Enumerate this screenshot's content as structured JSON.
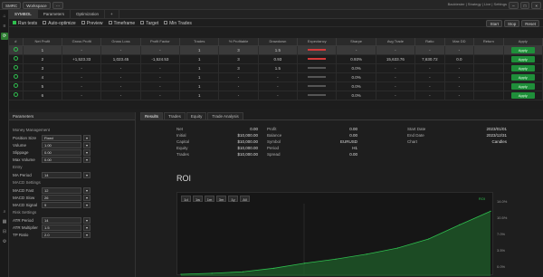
{
  "topbar": {
    "left_buttons": [
      "SMRC",
      "Workspace",
      "⋯"
    ],
    "right_text": "Backtester | Strategy | Live | Settings"
  },
  "tabs": [
    "SYMBOL",
    "Parameters",
    "Optimization",
    "+"
  ],
  "rail_icons": [
    "home-icon",
    "search-icon",
    "settings-icon",
    "chart-icon",
    "filter-icon",
    "settings-icon"
  ],
  "toolbar": {
    "items": [
      "Run tests",
      "Auto-optimize",
      "Preview",
      "Timeframe",
      "Target",
      "Min Trades"
    ],
    "buttons": [
      "Start",
      "Stop",
      "Reset"
    ]
  },
  "table": {
    "headers": [
      "#",
      "Net Profit",
      "Gross Profit",
      "Gross Loss",
      "Profit Factor",
      "Trades",
      "% Profitable",
      "Drawdown",
      "Expectancy",
      "Sharpe",
      "Avg Trade",
      "Ratio",
      "Max DD",
      "Return",
      "Apply"
    ],
    "rows": [
      {
        "n": "1",
        "np": "-",
        "gp": "-",
        "gl": "-",
        "pf": "1",
        "t": "3",
        "pp": "1.5",
        "dd_color": "red",
        "exp": "-",
        "sh": "-",
        "avg": "-",
        "rt": "-",
        "sel": true
      },
      {
        "n": "2",
        "np": "+1,523.33",
        "gp": "1,023.45",
        "gl": "-1,524.53",
        "pf": "1",
        "t": "3",
        "pp": "0.93",
        "dd_color": "red",
        "exp": "0.93%",
        "sh": "15,633.76",
        "avg": "7,630.72",
        "rt": "0.0",
        "sel": false
      },
      {
        "n": "3",
        "np": "-",
        "gp": "-",
        "gl": "-",
        "pf": "1",
        "t": "3",
        "pp": "1.5",
        "dd_color": "gray",
        "exp": "0.0%",
        "sh": "-",
        "avg": "-",
        "rt": "-",
        "sel": false
      },
      {
        "n": "4",
        "np": "-",
        "gp": "-",
        "gl": "-",
        "pf": "1",
        "t": "-",
        "pp": "-",
        "dd_color": "gray",
        "exp": "0.0%",
        "sh": "-",
        "avg": "-",
        "rt": "-",
        "sel": false
      },
      {
        "n": "5",
        "np": "-",
        "gp": "-",
        "gl": "-",
        "pf": "1",
        "t": "-",
        "pp": "-",
        "dd_color": "gray",
        "exp": "0.0%",
        "sh": "-",
        "avg": "-",
        "rt": "-",
        "sel": false
      },
      {
        "n": "6",
        "np": "-",
        "gp": "-",
        "gl": "-",
        "pf": "1",
        "t": "-",
        "pp": "-",
        "dd_color": "gray",
        "exp": "0.0%",
        "sh": "-",
        "avg": "-",
        "rt": "-",
        "sel": false
      }
    ],
    "apply_label": "Apply"
  },
  "left_panel": {
    "title": "Parameters",
    "section1": "Money Management",
    "rows1": [
      {
        "label": "Position Size",
        "value": "Fixed"
      },
      {
        "label": "Volume",
        "value": "1.00"
      },
      {
        "label": "Slippage",
        "value": "0.00"
      },
      {
        "label": "Max Volume",
        "value": "0.00"
      }
    ],
    "section2": "Entry",
    "rows2": [
      {
        "label": "MA Period",
        "value": "14"
      }
    ],
    "section3": "MACD Settings",
    "rows3": [
      {
        "label": "MACD Fast",
        "value": "12"
      },
      {
        "label": "MACD Slow",
        "value": "26"
      },
      {
        "label": "MACD Signal",
        "value": "9"
      }
    ],
    "section4": "Risk Settings",
    "rows4": [
      {
        "label": "ATR Period",
        "value": "14"
      },
      {
        "label": "ATR Multiplier",
        "value": "1.5"
      },
      {
        "label": "TP Ratio",
        "value": "2.0"
      }
    ]
  },
  "right_panel": {
    "tabs": [
      "Results",
      "Trades",
      "Equity",
      "Trade Analysis"
    ],
    "stats_col1": [
      {
        "k": "Net",
        "v": "0.00"
      },
      {
        "k": "Initial",
        "v": "$10,000.00"
      },
      {
        "k": "Capital",
        "v": "$10,000.00"
      },
      {
        "k": "Equity",
        "v": "$10,000.00"
      },
      {
        "k": "Trades",
        "v": "$10,000.00"
      }
    ],
    "stats_col2": [
      {
        "k": "Profit",
        "v": "0.00"
      },
      {
        "k": "Balance",
        "v": "0.00"
      },
      {
        "k": "Symbol",
        "v": "EURUSD"
      },
      {
        "k": "Period",
        "v": "H1"
      },
      {
        "k": "Spread",
        "v": "0.00"
      }
    ],
    "stats_col3": [
      {
        "k": "Start Date",
        "v": "2023/01/01"
      },
      {
        "k": "End Date",
        "v": "2023/12/31"
      },
      {
        "k": "Chart",
        "v": "Candles"
      }
    ],
    "roi_title": "ROI",
    "ranges": [
      "1d",
      "1w",
      "1m",
      "3m",
      "1y",
      "All"
    ],
    "legend": "ROI",
    "y_ticks": [
      "14.0%",
      "10.5%",
      "7.0%",
      "3.5%",
      "0.0%"
    ]
  },
  "chart_data": {
    "type": "area",
    "x": [
      0,
      1,
      2,
      3,
      4,
      5,
      6,
      7,
      8,
      9,
      10
    ],
    "values": [
      0,
      0.2,
      0.5,
      1.2,
      2.2,
      3.0,
      4.0,
      5.2,
      7.0,
      9.8,
      12.5
    ],
    "ylim": [
      0,
      14
    ]
  }
}
